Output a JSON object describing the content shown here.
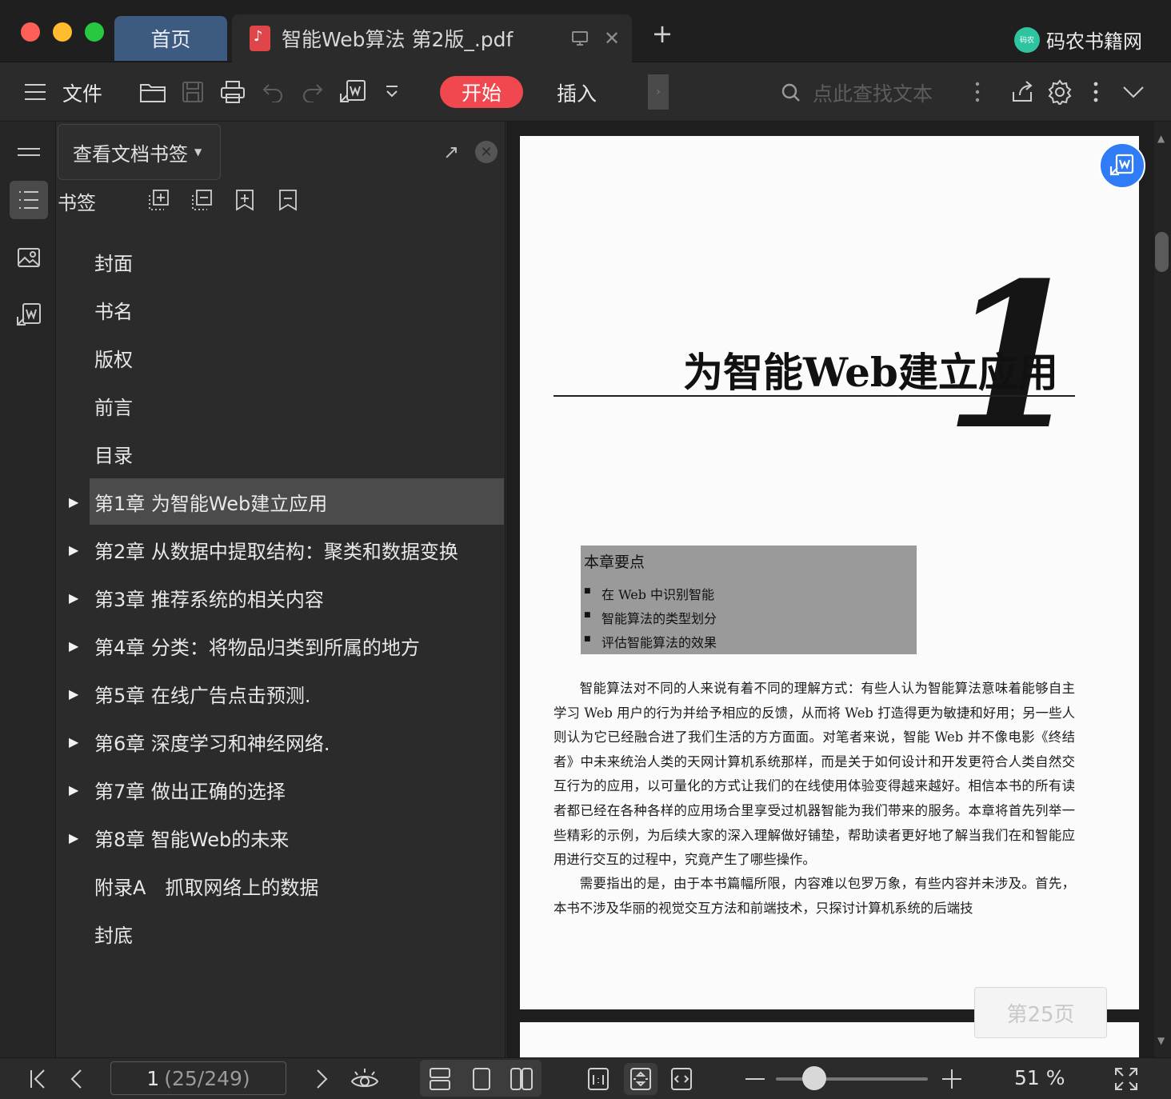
{
  "window": {
    "tabs": [
      {
        "label": "首页"
      },
      {
        "label": "智能Web算法 第2版_.pdf"
      }
    ],
    "brand": {
      "logo_text": "码农",
      "name": "码农书籍网"
    }
  },
  "toolbar": {
    "file_label": "文件",
    "start_label": "开始",
    "insert_label": "插入",
    "search_placeholder": "点此查找文本"
  },
  "panel": {
    "dropdown_label": "查看文档书签",
    "header": "书签",
    "bookmarks": [
      {
        "label": "封面",
        "expandable": false
      },
      {
        "label": "书名",
        "expandable": false
      },
      {
        "label": "版权",
        "expandable": false
      },
      {
        "label": "前言",
        "expandable": false
      },
      {
        "label": "目录",
        "expandable": false
      },
      {
        "label": "第1章 为智能Web建立应用",
        "expandable": true,
        "selected": true
      },
      {
        "label": "第2章 从数据中提取结构：聚类和数据变换",
        "expandable": true
      },
      {
        "label": "第3章 推荐系统的相关内容",
        "expandable": true
      },
      {
        "label": "第4章 分类：将物品归类到所属的地方",
        "expandable": true
      },
      {
        "label": "第5章 在线广告点击预测.",
        "expandable": true
      },
      {
        "label": "第6章 深度学习和神经网络.",
        "expandable": true
      },
      {
        "label": "第7章 做出正确的选择",
        "expandable": true
      },
      {
        "label": "第8章 智能Web的未来",
        "expandable": true
      },
      {
        "label": "附录A　抓取网络上的数据",
        "expandable": false
      },
      {
        "label": "封底",
        "expandable": false
      }
    ]
  },
  "document": {
    "chapter_number": "1",
    "chapter_title": "为智能Web建立应用",
    "key_points_title": "本章要点",
    "key_points": [
      "在 Web 中识别智能",
      "智能算法的类型划分",
      "评估智能算法的效果"
    ],
    "paragraphs": [
      "智能算法对不同的人来说有着不同的理解方式：有些人认为智能算法意味着能够自主学习 Web 用户的行为并给予相应的反馈，从而将 Web 打造得更为敏捷和好用；另一些人则认为它已经融合进了我们生活的方方面面。对笔者来说，智能 Web 并不像电影《终结者》中未来统治人类的天网计算机系统那样，而是关于如何设计和开发更符合人类自然交互行为的应用，以可量化的方式让我们的在线使用体验变得越来越好。相信本书的所有读者都已经在各种各样的应用场合里享受过机器智能为我们带来的服务。本章将首先列举一些精彩的示例，为后续大家的深入理解做好铺垫，帮助读者更好地了解当我们在和智能应用进行交互的过程中，究竟产生了哪些操作。",
      "需要指出的是，由于本书篇幅所限，内容难以包罗万象，有些内容并未涉及。首先，本书不涉及华丽的视觉交互方法和前端技术，只探讨计算机系统的后端技"
    ],
    "page_badge": "第25页"
  },
  "statusbar": {
    "page_current": "1",
    "page_total": "(25/249)",
    "zoom": "51 %",
    "zoom_fraction": 0.25
  },
  "colors": {
    "accent_red": "#f0484e",
    "home_tab": "#3d5a80",
    "fab_blue": "#2f7cf6"
  }
}
